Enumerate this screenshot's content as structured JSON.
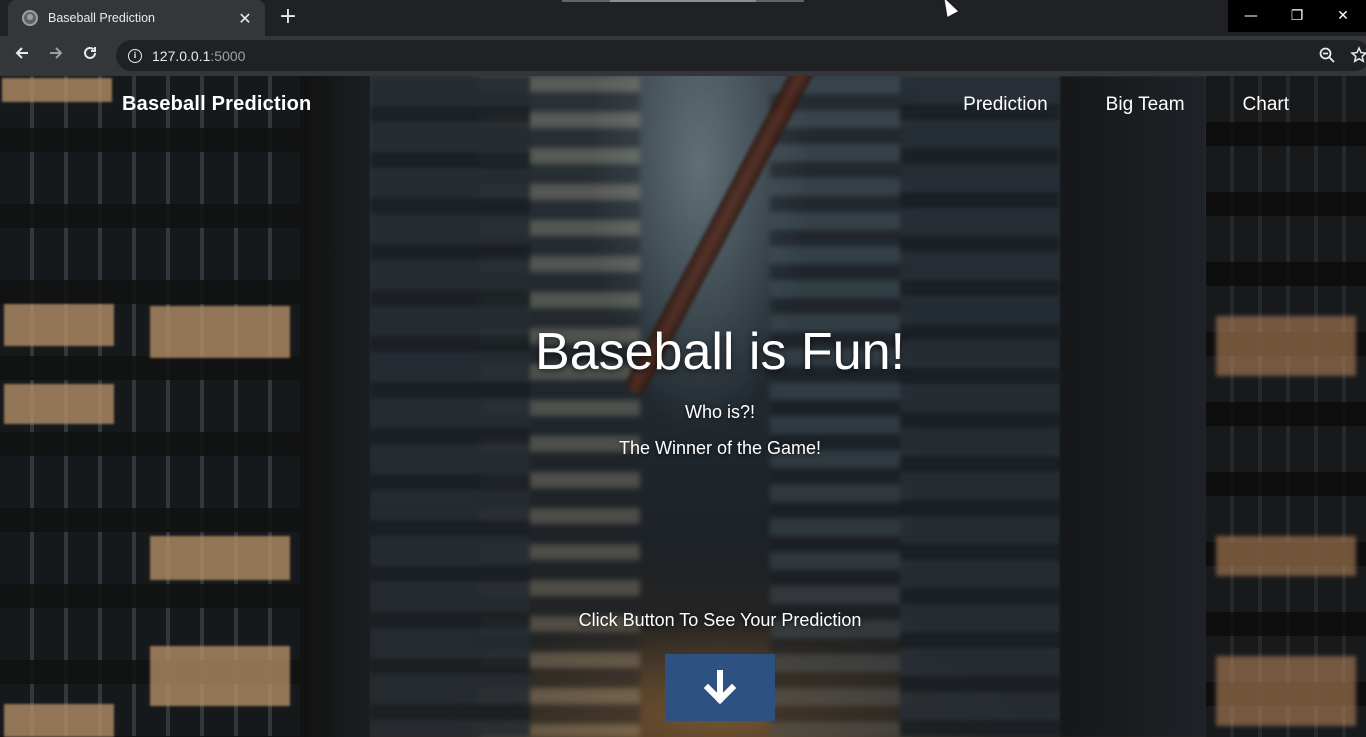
{
  "browser": {
    "tab_title": "Baseball Prediction",
    "tab_close": "✕",
    "new_tab": "+",
    "url_host": "127.0.0.1",
    "url_port": ":5000",
    "window_controls": {
      "minimize": "—",
      "restore": "❐",
      "close": "✕"
    }
  },
  "site": {
    "brand": "Baseball Prediction",
    "nav": [
      "Prediction",
      "Big Team",
      "Chart"
    ]
  },
  "hero": {
    "title": "Baseball is Fun!",
    "subtitle_1": "Who is?!",
    "subtitle_2": "The Winner of the Game!",
    "cta_text": "Click Button To See Your Prediction"
  },
  "colors": {
    "cta_button": "#2d5281",
    "chrome_dark": "#202124",
    "chrome_toolbar": "#35363a"
  },
  "icons": {
    "cta": "arrow-down-icon",
    "back": "back-arrow-icon",
    "forward": "forward-arrow-icon",
    "reload": "reload-icon",
    "info": "info-icon",
    "zoom": "zoom-icon",
    "bookmark": "star-icon"
  }
}
